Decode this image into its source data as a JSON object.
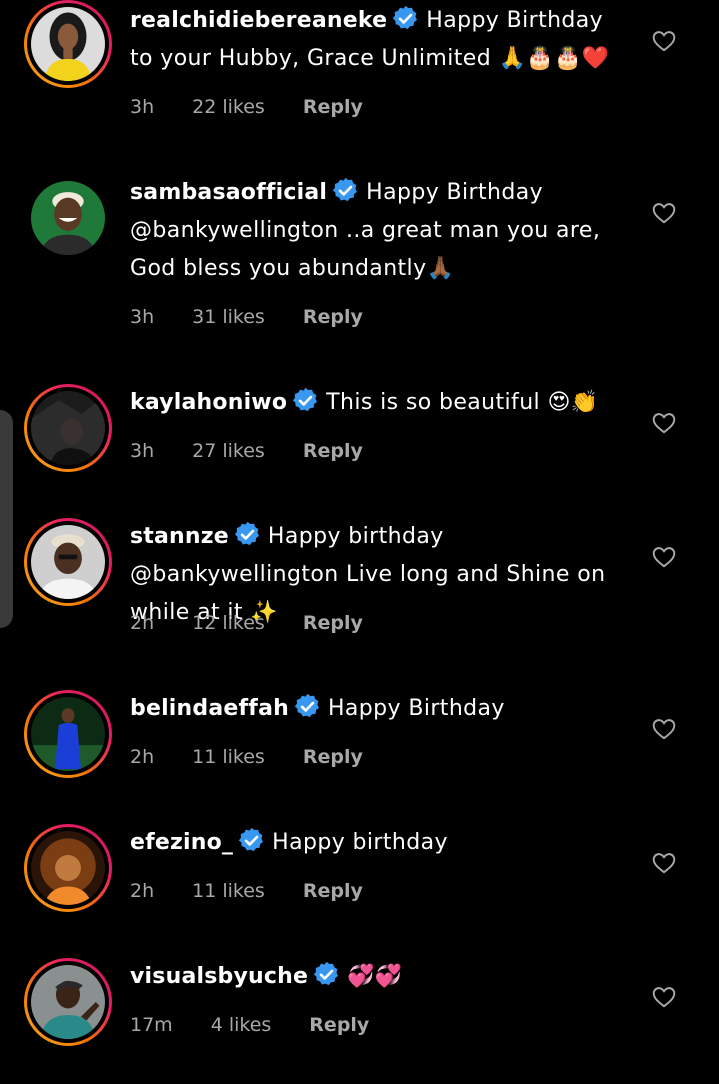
{
  "colors": {
    "background": "#000000",
    "text": "#ffffff",
    "meta": "#a8a8a8",
    "verified": "#3897f0"
  },
  "comments": [
    {
      "username": "realchidiebereaneke",
      "text": "Happy Birthday to your Hubby, Grace Unlimited 🙏🎂🎂❤️",
      "time": "3h",
      "likes": "22 likes",
      "reply": "Reply",
      "has_story": true,
      "avatar": "woman-yellow-top",
      "icons": [
        "verified-badge-icon",
        "heart-outline-icon"
      ]
    },
    {
      "username": "sambasaofficial",
      "text": "Happy Birthday @bankywellington ..a great man you are, God bless you abundantly🙏🏾",
      "time": "3h",
      "likes": "31 likes",
      "reply": "Reply",
      "has_story": false,
      "avatar": "man-green-background",
      "icons": [
        "verified-badge-icon",
        "heart-outline-icon"
      ]
    },
    {
      "username": "kaylahoniwo",
      "text": "This is so beautiful 😍👏",
      "time": "3h",
      "likes": "27 likes",
      "reply": "Reply",
      "has_story": true,
      "avatar": "dark-portrait",
      "icons": [
        "verified-badge-icon",
        "heart-outline-icon"
      ]
    },
    {
      "username": "stannze",
      "text": "Happy birthday @bankywellington Live long and Shine on while at it ✨",
      "time": "2h",
      "likes": "12 likes",
      "reply": "Reply",
      "has_story": true,
      "avatar": "man-white-shirt",
      "icons": [
        "verified-badge-icon",
        "heart-outline-icon"
      ]
    },
    {
      "username": "belindaeffah",
      "text": "Happy Birthday",
      "time": "2h",
      "likes": "11 likes",
      "reply": "Reply",
      "has_story": true,
      "avatar": "woman-blue-dress",
      "icons": [
        "verified-badge-icon",
        "heart-outline-icon"
      ]
    },
    {
      "username": "efezino_",
      "text": "Happy birthday",
      "time": "2h",
      "likes": "11 likes",
      "reply": "Reply",
      "has_story": true,
      "avatar": "woman-curly-hair-warm",
      "icons": [
        "verified-badge-icon",
        "heart-outline-icon"
      ]
    },
    {
      "username": "visualsbyuche",
      "text": "💞💞",
      "time": "17m",
      "likes": "4 likes",
      "reply": "Reply",
      "has_story": true,
      "avatar": "man-teal-shirt",
      "icons": [
        "verified-badge-icon",
        "heart-outline-icon"
      ]
    }
  ]
}
